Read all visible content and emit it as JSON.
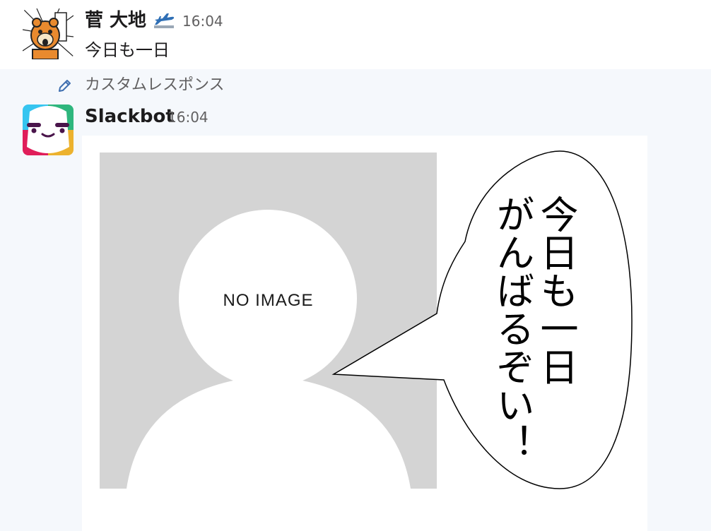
{
  "messages": [
    {
      "author": "菅 大地",
      "status_icon": "airplane-icon",
      "time": "16:04",
      "text": "今日も一日"
    },
    {
      "author": "Slackbot",
      "time": "16:04",
      "response_label": "カスタムレスポンス",
      "image": {
        "placeholder_text": "NO IMAGE",
        "bubble_line1": "今日も一日",
        "bubble_line2": "がんばるぞい！"
      }
    }
  ],
  "colors": {
    "background": "#ffffff",
    "highlight_background": "#f5f8fc",
    "secondary_text": "#616061",
    "placeholder_gray": "#d4d4d4"
  }
}
